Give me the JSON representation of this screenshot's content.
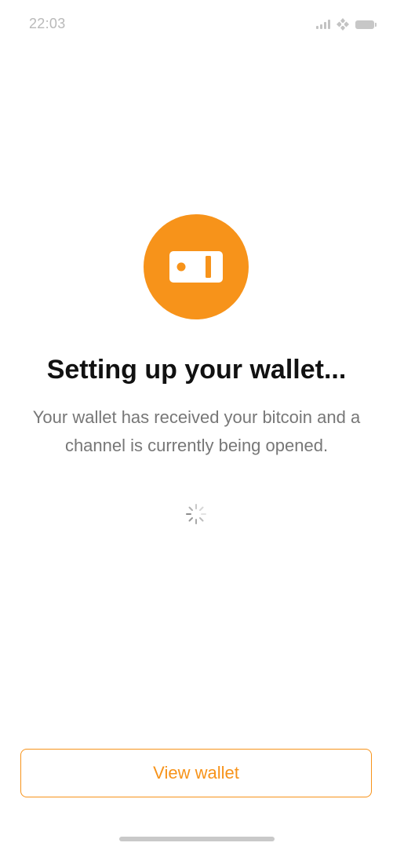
{
  "status_bar": {
    "time": "22:03",
    "icons": [
      "signal-icon",
      "wifi-icon",
      "battery-icon"
    ]
  },
  "hero": {
    "icon": "wallet-icon",
    "accent_color": "#f7931a"
  },
  "content": {
    "title": "Setting up your wallet...",
    "description": "Your wallet has received your bitcoin and a channel is currently being opened."
  },
  "actions": {
    "view_wallet_label": "View wallet"
  }
}
